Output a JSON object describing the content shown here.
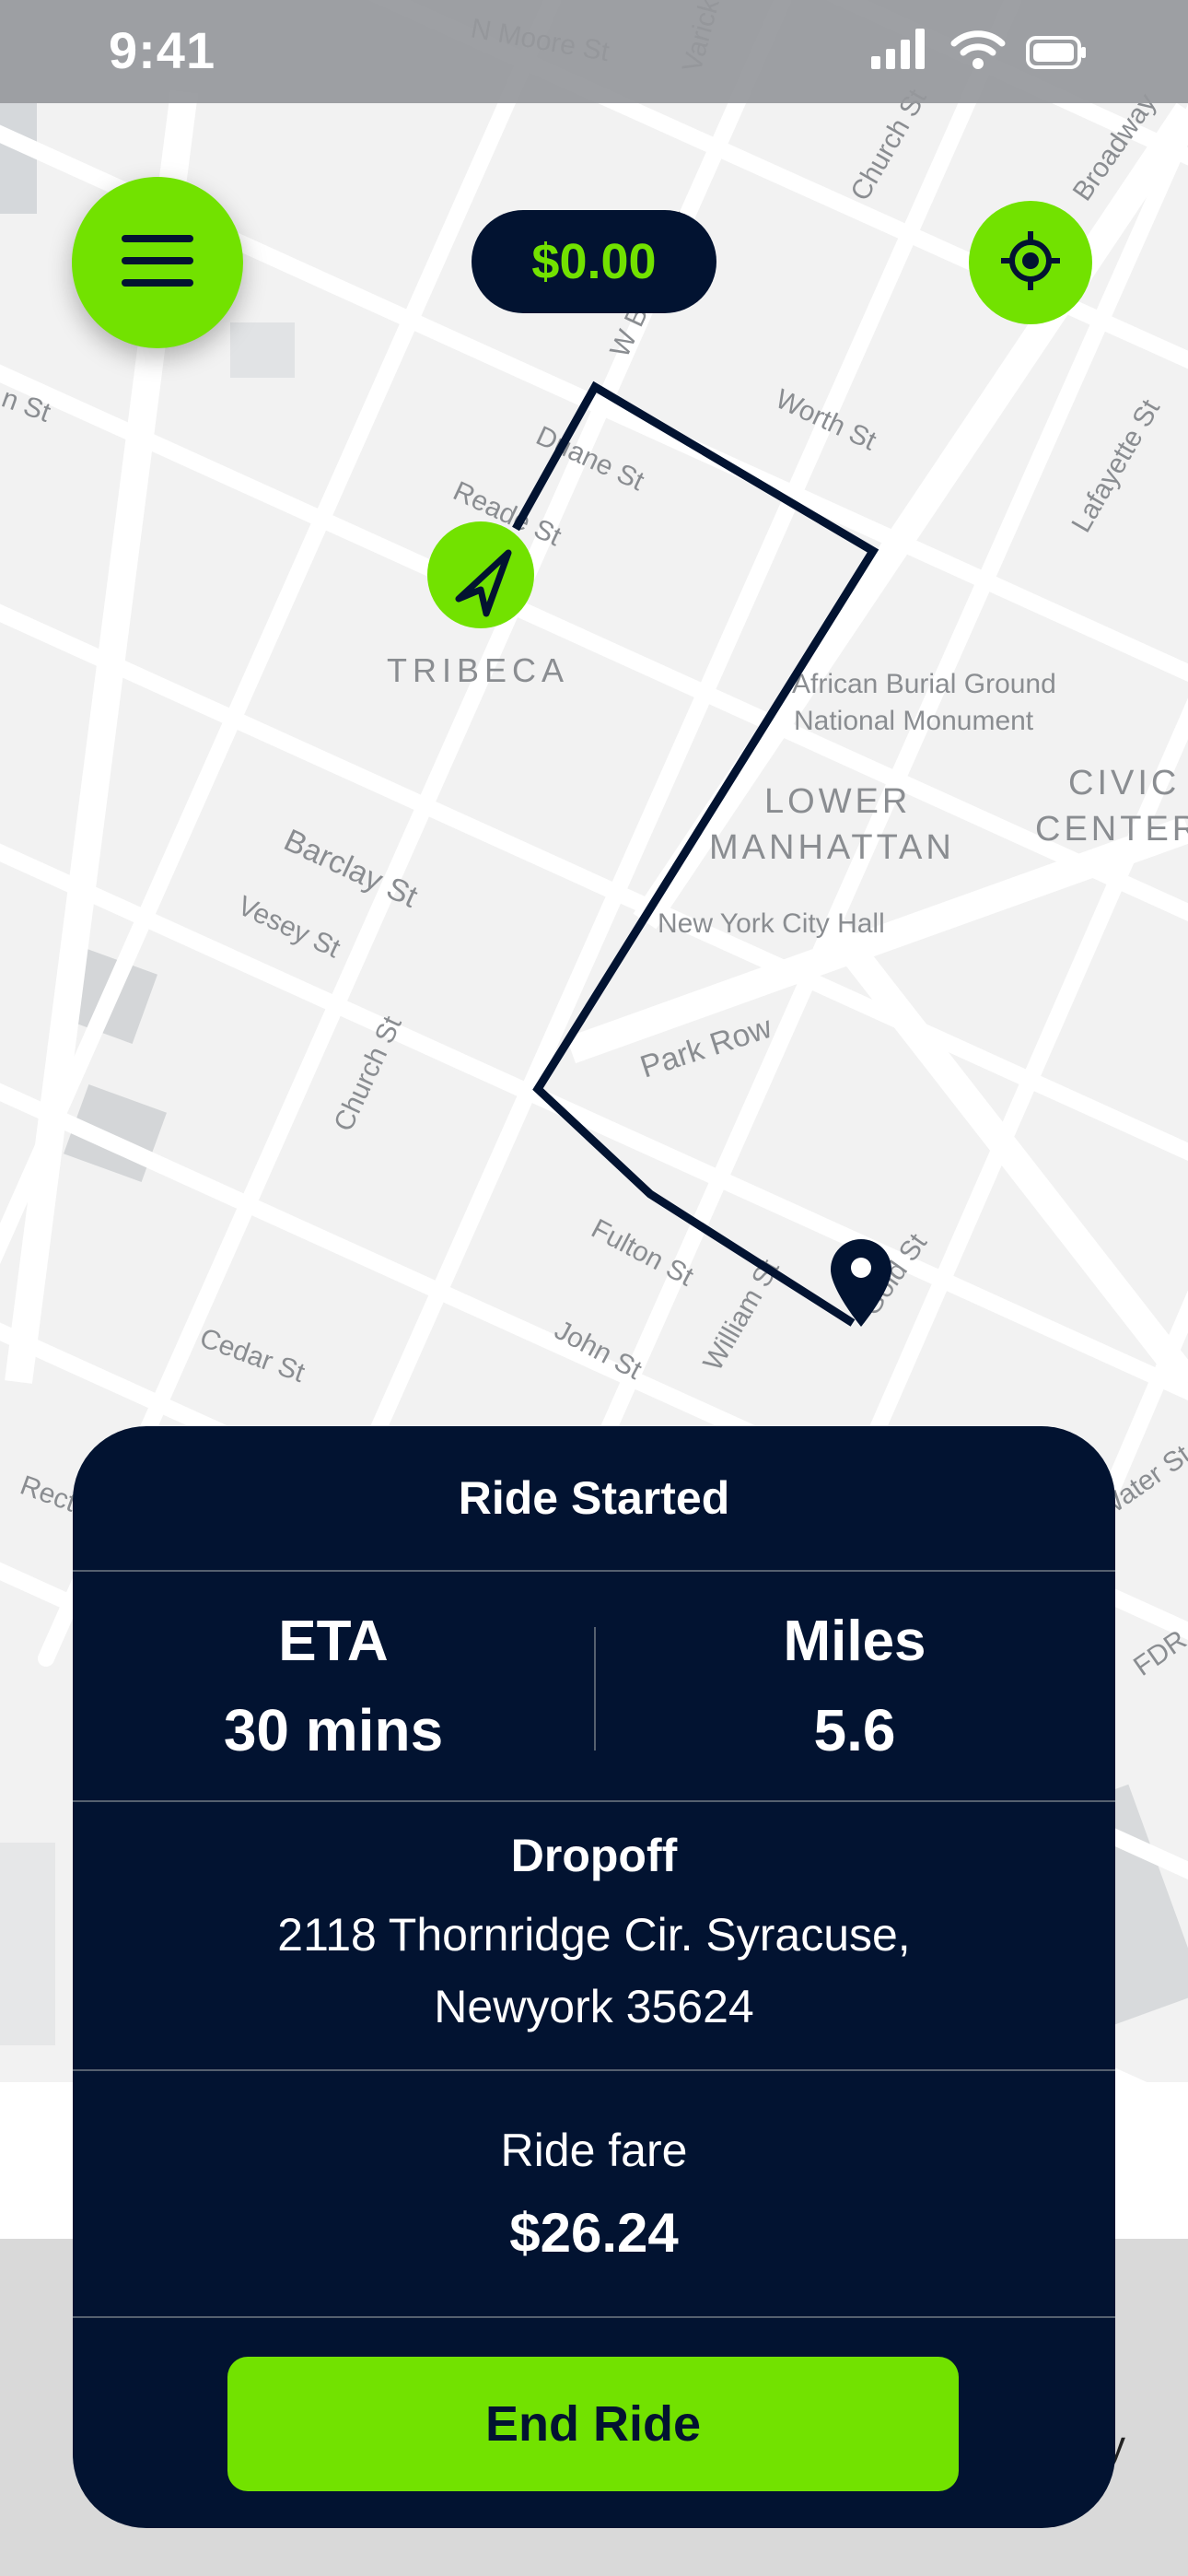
{
  "status_bar": {
    "time": "9:41",
    "icons": [
      "cellular-signal-icon",
      "wifi-icon",
      "battery-icon"
    ]
  },
  "map": {
    "street_labels": [
      "N Moore St",
      "Varick St",
      "Church St",
      "Broadway",
      "Worth St",
      "Lafayette St",
      "Duane St",
      "Reade St",
      "W Broadway",
      "Barclay St",
      "Vesey St",
      "Church St",
      "Park Row",
      "Fulton St",
      "John St",
      "William St",
      "Gold St",
      "Cedar St",
      "Water St",
      "FDR"
    ],
    "area_labels": [
      "TRIBECA",
      "African Burial Ground",
      "National Monument",
      "LOWER",
      "MANHATTAN",
      "CIVIC",
      "CENTER",
      "New York City Hall"
    ],
    "route_color": "#021331"
  },
  "controls": {
    "menu_icon": "hamburger-menu-icon",
    "balance": "$0.00",
    "locate_icon": "crosshair-locate-icon"
  },
  "ride": {
    "title": "Ride Started",
    "eta_label": "ETA",
    "eta_value": "30 mins",
    "miles_label": "Miles",
    "miles_value": "5.6",
    "dropoff_label": "Dropoff",
    "dropoff_address": "2118 Thornridge Cir. Syracuse, Newyork 35624",
    "fare_label": "Ride fare",
    "fare_value": "$26.24",
    "end_button": "End Ride"
  },
  "colors": {
    "accent": "#72e200",
    "navy": "#021331",
    "map_bg": "#f3f3f3"
  }
}
